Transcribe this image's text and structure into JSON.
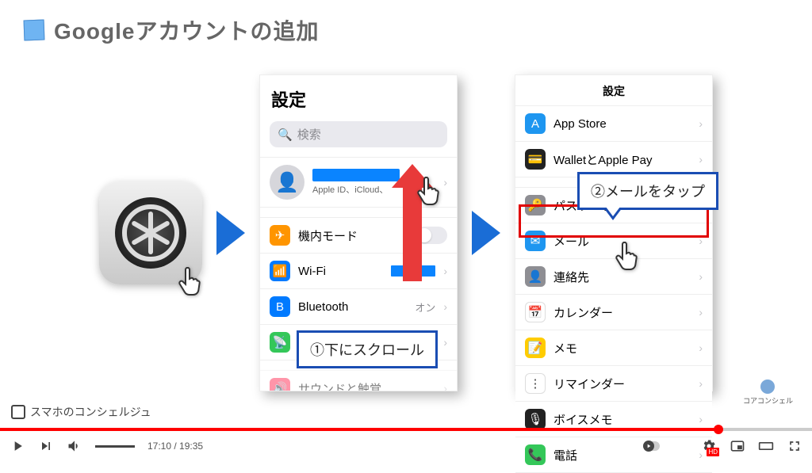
{
  "slide": {
    "title": "Googleアカウントの追加",
    "step1_callout": "①下にスクロール",
    "step2_callout": "②メールをタップ",
    "brand": "コアコンシェル"
  },
  "phone1": {
    "title": "設定",
    "search_placeholder": "検索",
    "apple_id_sub": "Apple ID、iCloud、",
    "items": {
      "airplane": "機内モード",
      "wifi": "Wi-Fi",
      "bluetooth": "Bluetooth",
      "bluetooth_val": "オン",
      "mobile": "モバイル通信",
      "sound": "サウンドと触覚"
    }
  },
  "phone2": {
    "title": "設定",
    "items": {
      "appstore": "App Store",
      "wallet": "WalletとApple Pay",
      "password": "パスワード",
      "mail": "メール",
      "contacts": "連絡先",
      "calendar": "カレンダー",
      "notes": "メモ",
      "reminders": "リマインダー",
      "voicememos": "ボイスメモ",
      "phone": "電話"
    }
  },
  "video": {
    "current": "17:10",
    "total": "19:35",
    "channel": "スマホのコンシェルジュ"
  }
}
